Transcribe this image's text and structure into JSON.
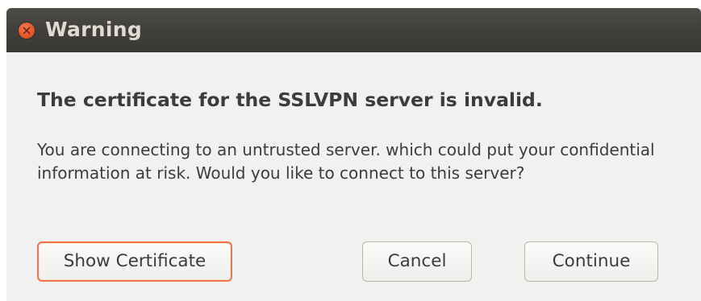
{
  "window": {
    "title": "Warning"
  },
  "dialog": {
    "heading": "The certificate for the SSLVPN server is invalid.",
    "message": "You are connecting to an untrusted server. which could put your confidential information at risk. Would you like to connect to this server?"
  },
  "buttons": {
    "show_certificate": "Show Certificate",
    "cancel": "Cancel",
    "continue": "Continue"
  },
  "icons": {
    "close": "close-icon"
  },
  "colors": {
    "titlebar": "#3f3e3a",
    "close_button": "#e2562a",
    "focus_ring": "#f0744a",
    "dialog_background": "#f2f1f0",
    "text": "#3c3c3c"
  }
}
